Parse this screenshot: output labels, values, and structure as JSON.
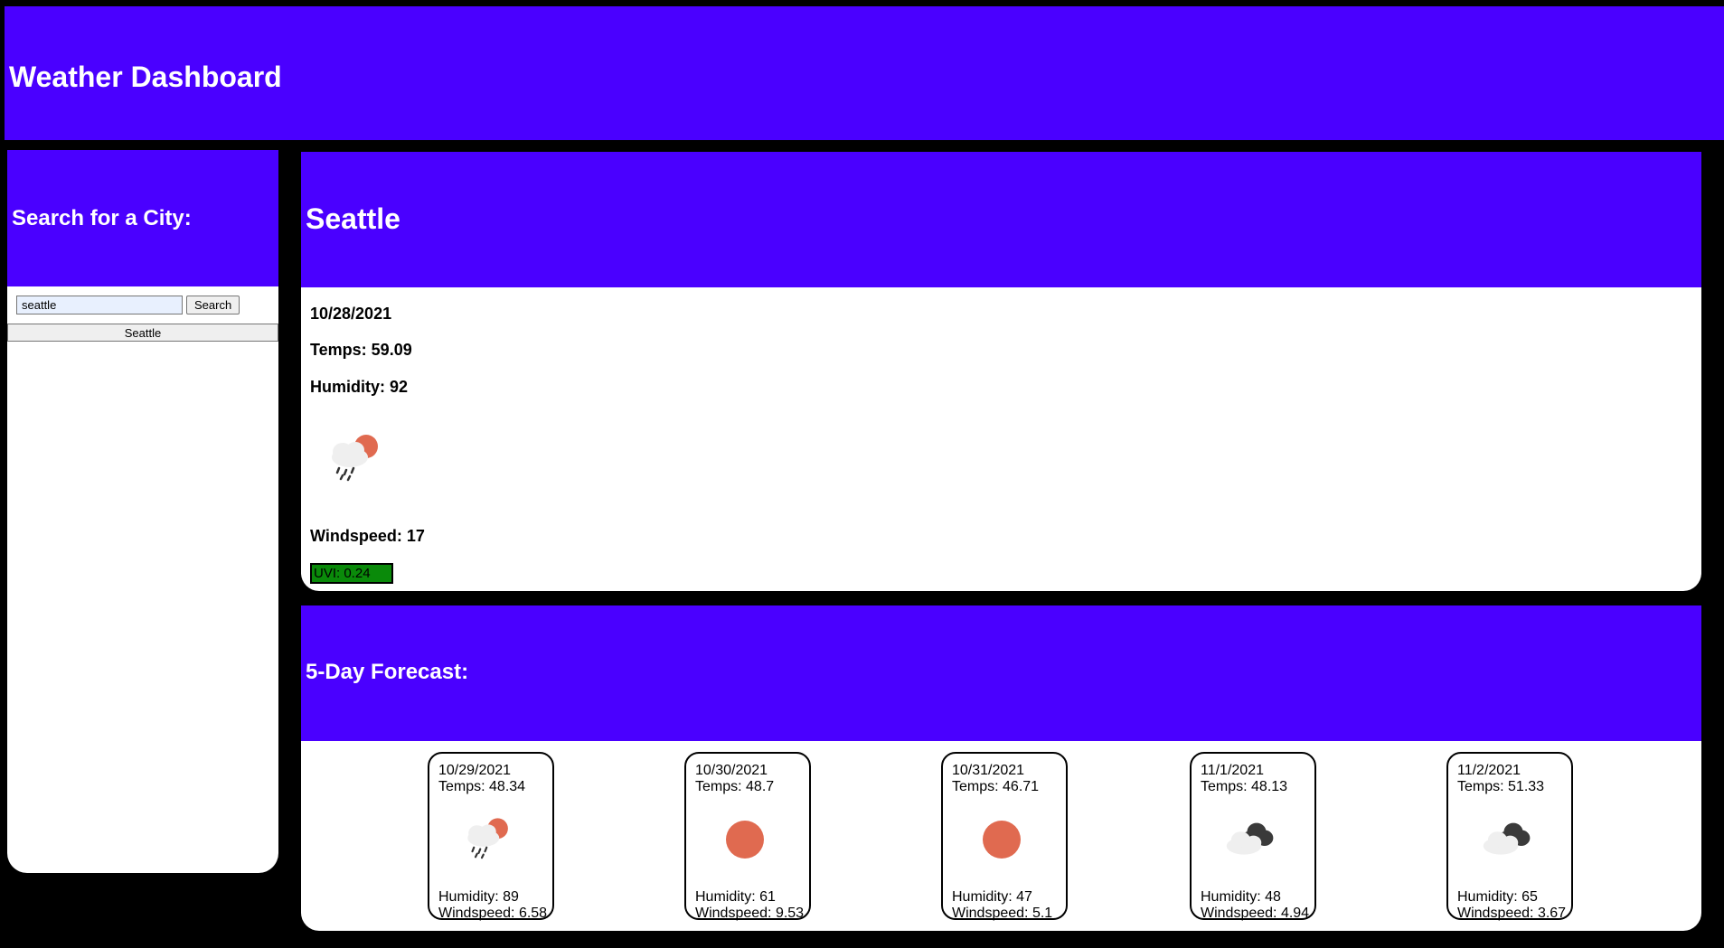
{
  "header": {
    "title": "Weather Dashboard"
  },
  "sidebar": {
    "heading": "Search for a City:",
    "search_value": "seattle",
    "search_button": "Search",
    "history": [
      "Seattle"
    ]
  },
  "current": {
    "city": "Seattle",
    "date": "10/28/2021",
    "temps": "Temps: 59.09",
    "humidity": "Humidity: 92",
    "icon": "rain-sun-icon",
    "windspeed": "Windspeed: 17",
    "uvi": "UVI: 0.24",
    "uvi_color": "#0a8a0a"
  },
  "forecast": {
    "heading": "5-Day Forecast:",
    "days": [
      {
        "date": "10/29/2021",
        "temps": "Temps: 48.34",
        "icon": "rain-sun-icon",
        "humidity": "Humidity: 89",
        "windspeed": "Windspeed: 6.58"
      },
      {
        "date": "10/30/2021",
        "temps": "Temps: 48.7",
        "icon": "sun-icon",
        "humidity": "Humidity: 61",
        "windspeed": "Windspeed: 9.53"
      },
      {
        "date": "10/31/2021",
        "temps": "Temps: 46.71",
        "icon": "sun-icon",
        "humidity": "Humidity: 47",
        "windspeed": "Windspeed: 5.1"
      },
      {
        "date": "11/1/2021",
        "temps": "Temps: 48.13",
        "icon": "broken-clouds-icon",
        "humidity": "Humidity: 48",
        "windspeed": "Windspeed: 4.94"
      },
      {
        "date": "11/2/2021",
        "temps": "Temps: 51.33",
        "icon": "broken-clouds-icon",
        "humidity": "Humidity: 65",
        "windspeed": "Windspeed: 3.67"
      }
    ]
  },
  "colors": {
    "accent": "#4a00ff",
    "sun": "#e06a50"
  }
}
